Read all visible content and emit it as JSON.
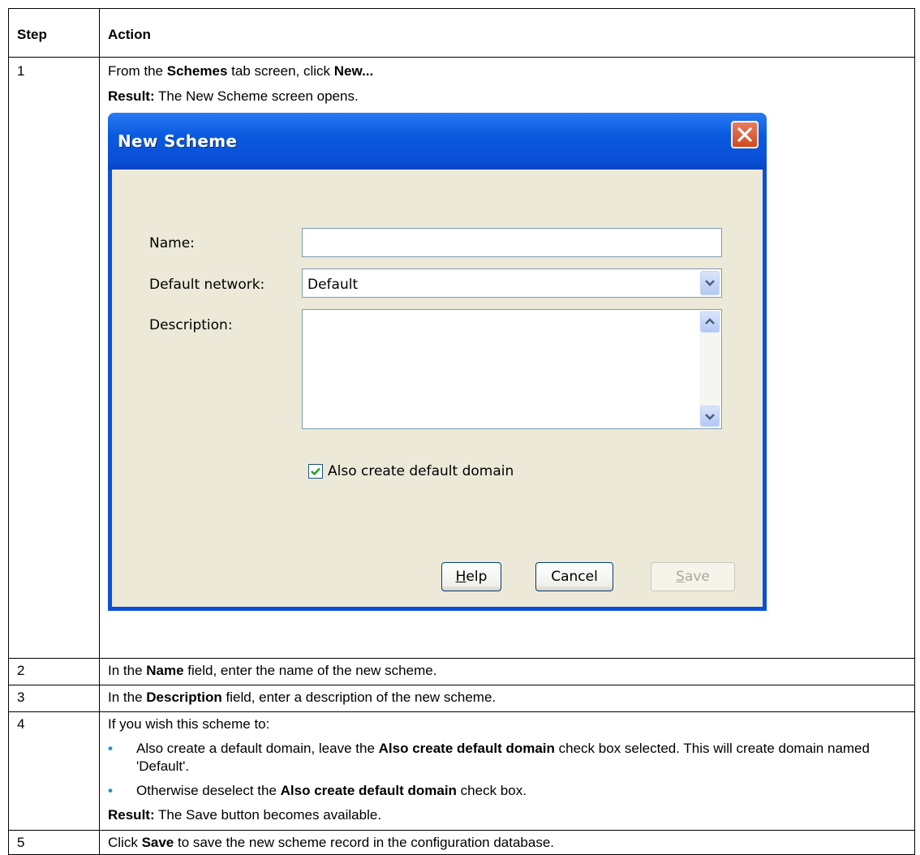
{
  "table": {
    "headers": [
      "Step",
      "Action"
    ],
    "steps": [
      {
        "num": "1",
        "line1": [
          "From the ",
          "Schemes",
          " tab screen, click ",
          "New..."
        ],
        "line2": [
          "Result:",
          " The New Scheme screen opens."
        ]
      },
      {
        "num": "2",
        "text": [
          "In the ",
          "Name",
          " field, enter the name of the new scheme."
        ]
      },
      {
        "num": "3",
        "text": [
          "In the ",
          "Description",
          " field, enter a description of the new scheme."
        ]
      },
      {
        "num": "4",
        "intro": "If you wish this scheme to:",
        "bullet1": [
          "Also create a default domain, leave the ",
          "Also create default domain",
          " check box selected. This will create domain named 'Default'."
        ],
        "bullet2": [
          "Otherwise deselect the ",
          "Also create default domain",
          " check box."
        ],
        "result": [
          "Result:",
          " The Save button becomes available."
        ]
      },
      {
        "num": "5",
        "text": [
          "Click ",
          "Save",
          " to save the new scheme record in the configuration database."
        ]
      }
    ],
    "bullet_glyph": "•"
  },
  "dialog": {
    "title": "New Scheme",
    "name_label": "Name:",
    "name_value": "",
    "network_label": "Default network:",
    "network_value": "Default",
    "description_label": "Description:",
    "description_value": "",
    "checkbox_label": "Also create default domain",
    "checkbox_checked": true,
    "help_button": {
      "mnemonic": "H",
      "rest": "elp"
    },
    "cancel_button": "Cancel",
    "save_button": {
      "mnemonic": "S",
      "rest": "ave"
    }
  },
  "colors": {
    "titlebar": "#0a50d8",
    "dialog_face": "#ece9d8",
    "bullet": "#1f8fce",
    "close_button": "#d04a1f"
  }
}
